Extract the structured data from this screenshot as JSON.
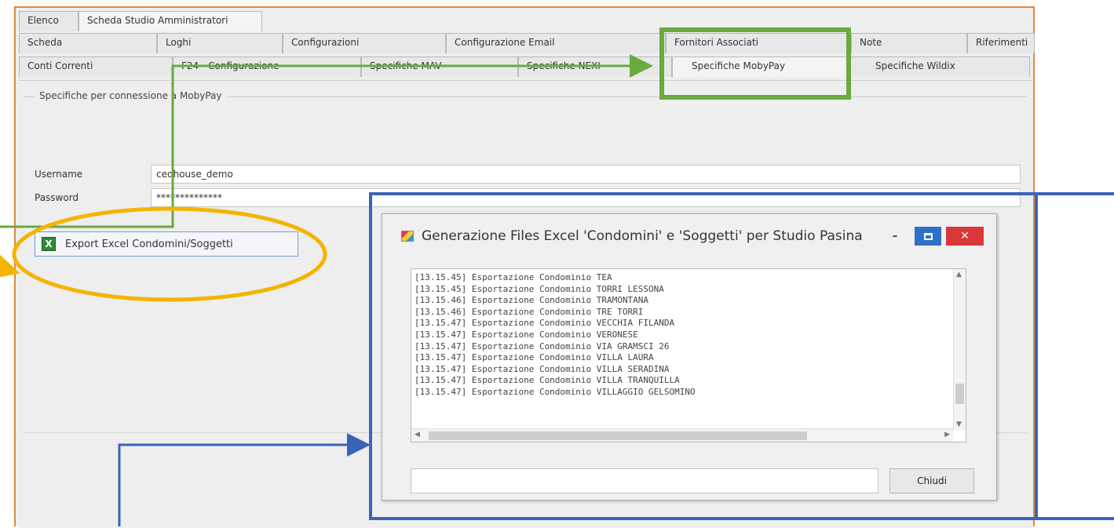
{
  "tabs": {
    "row0": [
      "Elenco",
      "Scheda Studio Amministratori"
    ],
    "row1": [
      "Scheda",
      "Loghi",
      "Configurazioni",
      "Configurazione Email",
      "Fornitori Associati",
      "Note",
      "Riferimenti"
    ],
    "row2": [
      "Conti Correnti",
      "F24 - Configurazione",
      "Specifiche MAV",
      "Specifiche NEXI",
      "Specifiche MobyPay",
      "Specifiche Wildix"
    ],
    "active_row0": "Scheda Studio Amministratori",
    "active_row2": "Specifiche MobyPay"
  },
  "group": {
    "title": "Specifiche per connessione a MobyPay"
  },
  "form": {
    "username_label": "Username",
    "username_value": "cedhouse_demo",
    "password_label": "Password",
    "password_value": "**************"
  },
  "export_button": {
    "label": "Export Excel Condomini/Soggetti",
    "icon": "excel-icon"
  },
  "dialog": {
    "title": "Generazione Files Excel 'Condomini' e 'Soggetti' per Studio Pasina",
    "minimize": "–",
    "close": "✕",
    "log": [
      "[13.15.45] Esportazione Condominio TEA",
      "[13.15.45] Esportazione Condominio TORRI LESSONA",
      "[13.15.46] Esportazione Condominio TRAMONTANA",
      "[13.15.46] Esportazione Condominio TRE TORRI",
      "[13.15.47] Esportazione Condominio VECCHIA FILANDA",
      "[13.15.47] Esportazione Condominio VERONESE",
      "[13.15.47] Esportazione Condominio VIA GRAMSCI 26",
      "[13.15.47] Esportazione Condominio VILLA LAURA",
      "[13.15.47] Esportazione Condominio VILLA SERADINA",
      "[13.15.47] Esportazione Condominio VILLA TRANQUILLA",
      "[13.15.47] Esportazione Condominio VILLAGGIO GELSOMINO"
    ],
    "input_value": "",
    "close_button": "Chiudi"
  },
  "colors": {
    "window_border": "#e0873a",
    "highlight_green": "#6aaa3e",
    "highlight_blue": "#3a64b8",
    "highlight_yellow": "#f4b400"
  }
}
